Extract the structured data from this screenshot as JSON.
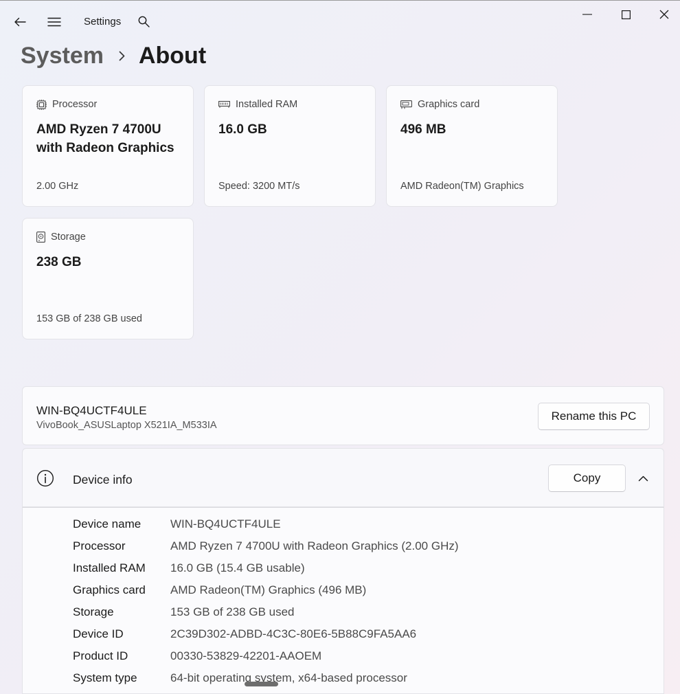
{
  "window": {
    "app_title": "Settings",
    "controls": {
      "minimize": "minimize-icon",
      "maximize": "maximize-icon",
      "close": "close-icon"
    }
  },
  "breadcrumb": {
    "parent": "System",
    "current": "About"
  },
  "specs": {
    "processor": {
      "label": "Processor",
      "value": "AMD Ryzen 7 4700U with Radeon Graphics",
      "sub": "2.00 GHz"
    },
    "ram": {
      "label": "Installed RAM",
      "value": "16.0 GB",
      "sub": "Speed: 3200 MT/s"
    },
    "graphics": {
      "label": "Graphics card",
      "value": "496 MB",
      "sub": "AMD Radeon(TM) Graphics"
    },
    "storage": {
      "label": "Storage",
      "value": "238 GB",
      "sub": "153 GB of 238 GB used"
    }
  },
  "pc": {
    "name": "WIN-BQ4UCTF4ULE",
    "model": "VivoBook_ASUSLaptop X521IA_M533IA",
    "rename_label": "Rename this PC"
  },
  "device_info": {
    "title": "Device info",
    "copy_label": "Copy",
    "rows": [
      {
        "label": "Device name",
        "value": "WIN-BQ4UCTF4ULE"
      },
      {
        "label": "Processor",
        "value": "AMD Ryzen 7 4700U with Radeon Graphics (2.00 GHz)"
      },
      {
        "label": "Installed RAM",
        "value": "16.0 GB (15.4 GB usable)"
      },
      {
        "label": "Graphics card",
        "value": "AMD Radeon(TM) Graphics (496 MB)"
      },
      {
        "label": "Storage",
        "value": "153 GB of 238 GB used"
      },
      {
        "label": "Device ID",
        "value": "2C39D302-ADBD-4C3C-80E6-5B88C9FA5AA6"
      },
      {
        "label": "Product ID",
        "value": "00330-53829-42201-AAOEM"
      },
      {
        "label": "System type",
        "value": "64-bit operating system, x64-based processor"
      }
    ]
  },
  "colors": {
    "background": "#eef1f8",
    "card": "#fbfbfd",
    "border": "#e3e3e8",
    "text": "#1b1b1b",
    "muted": "#444444"
  }
}
